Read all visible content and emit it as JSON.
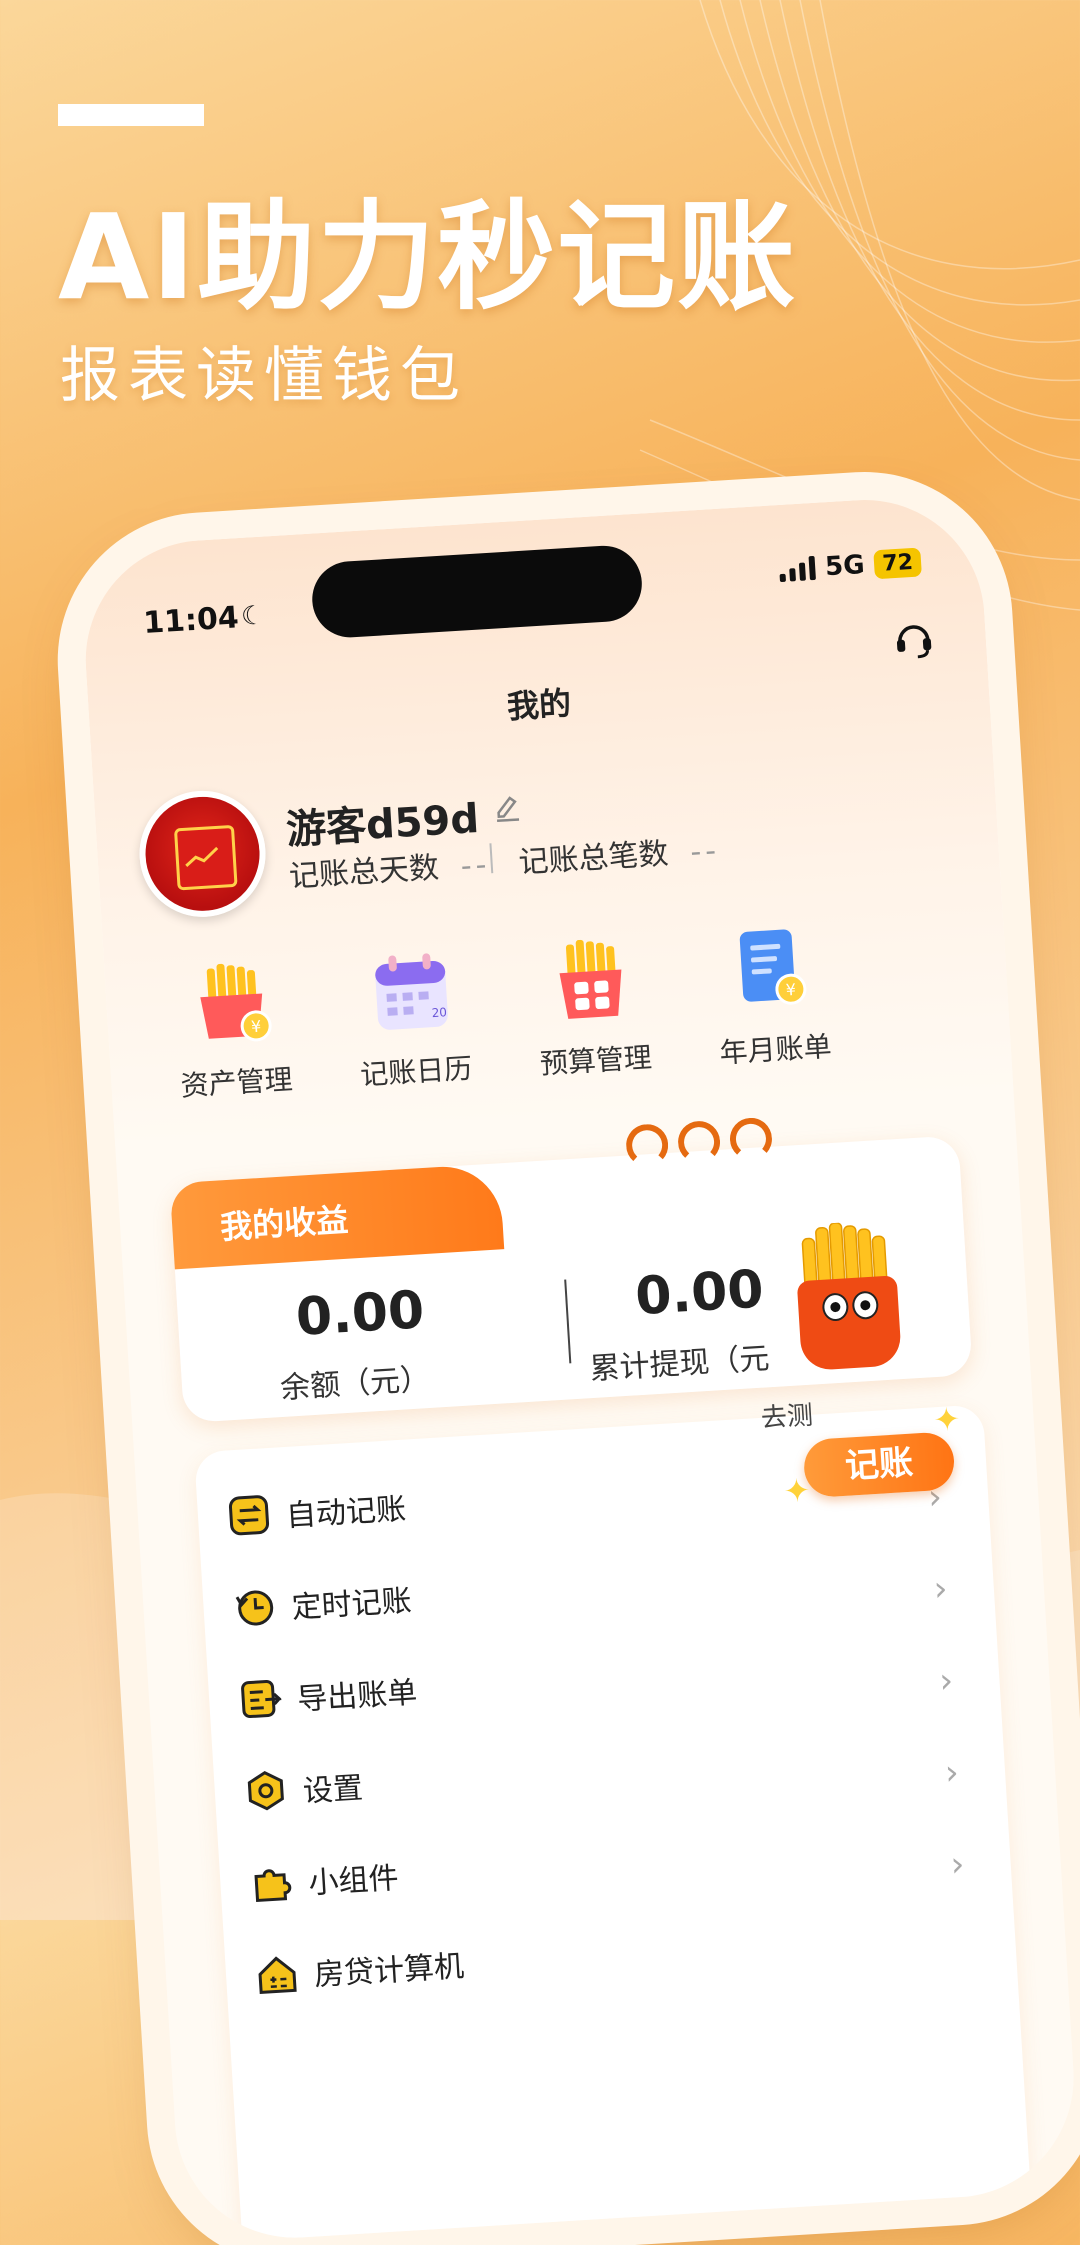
{
  "promo": {
    "headline": "AI助力秒记账",
    "subheadline": "报表读懂钱包"
  },
  "status_bar": {
    "time": "11:04",
    "network": "5G",
    "battery": "72"
  },
  "header": {
    "title": "我的"
  },
  "profile": {
    "name": "游客d59d",
    "total_days_label": "记账总天数",
    "total_days_value": "--",
    "total_records_label": "记账总笔数",
    "total_records_value": "--"
  },
  "quick_actions": [
    {
      "label": "资产管理",
      "icon": "fries-coin-icon"
    },
    {
      "label": "记账日历",
      "icon": "calendar-icon"
    },
    {
      "label": "预算管理",
      "icon": "calculator-fries-icon"
    },
    {
      "label": "年月账单",
      "icon": "bill-document-icon"
    }
  ],
  "earnings": {
    "tab_label": "我的收益",
    "balance_value": "0.00",
    "balance_label": "余额（元）",
    "withdrawn_value": "0.00",
    "withdrawn_label": "累计提现（元",
    "go_label": "去测",
    "float_button": "记账"
  },
  "menu": [
    {
      "label": "自动记账",
      "icon": "auto-sync-icon"
    },
    {
      "label": "定时记账",
      "icon": "clock-history-icon"
    },
    {
      "label": "导出账单",
      "icon": "export-icon"
    },
    {
      "label": "设置",
      "icon": "settings-icon"
    },
    {
      "label": "小组件",
      "icon": "puzzle-icon"
    },
    {
      "label": "房贷计算机",
      "icon": "house-calculator-icon"
    }
  ],
  "colors": {
    "accent": "#ff7a1a",
    "icon_yellow": "#f6c21a",
    "background": "#f7b25a"
  }
}
